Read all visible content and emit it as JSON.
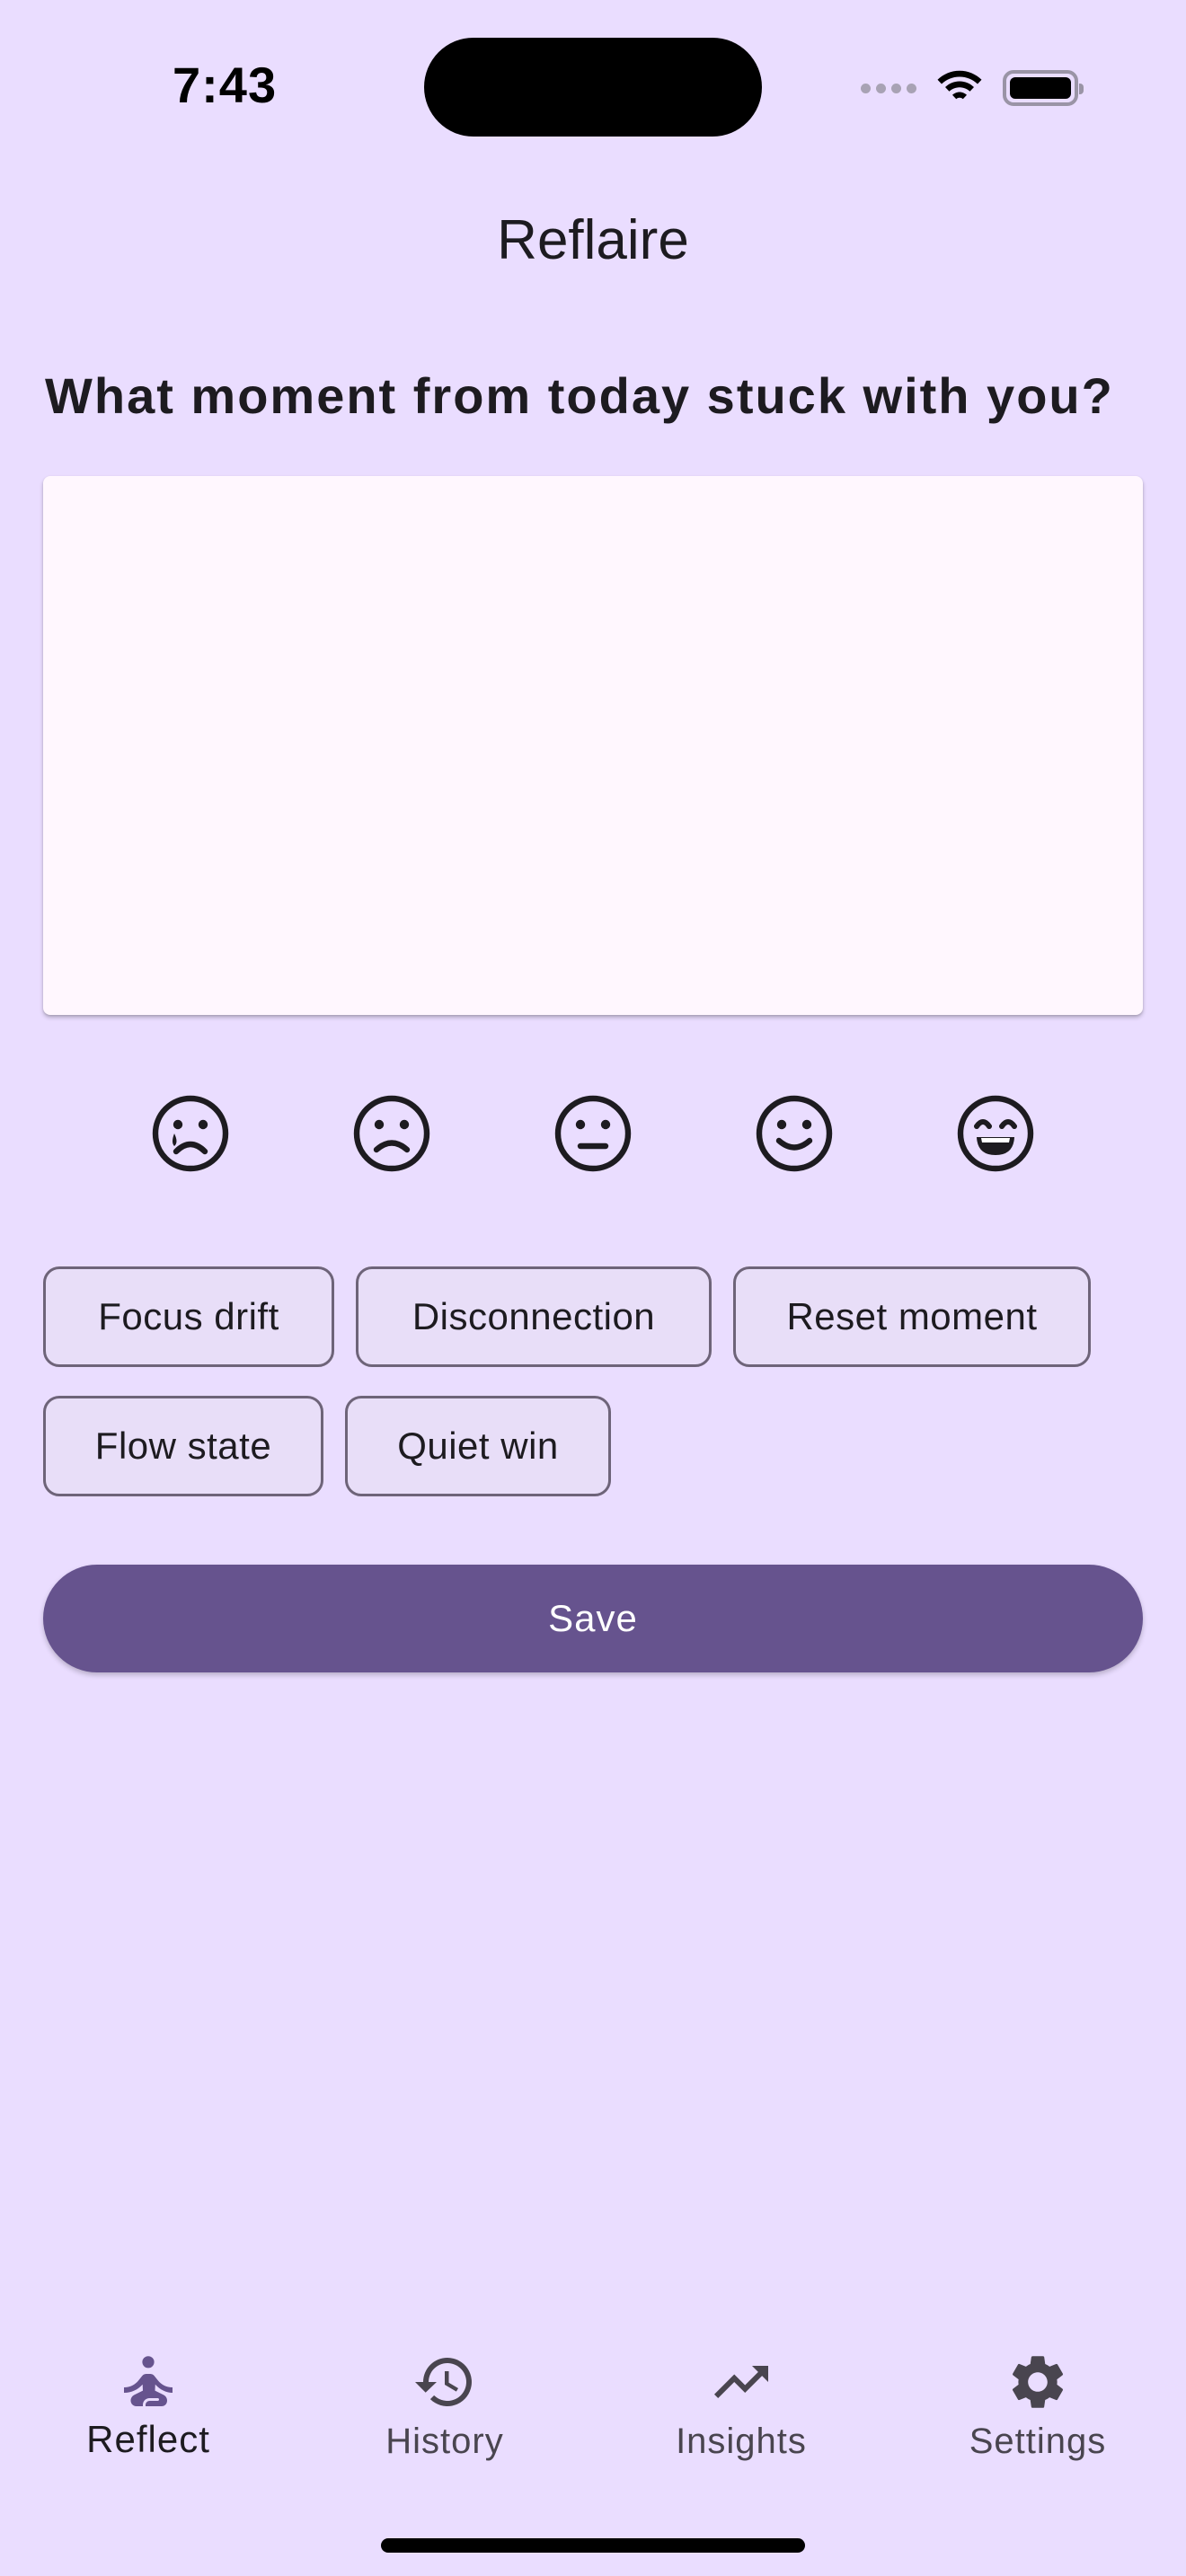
{
  "status_bar": {
    "time": "7:43"
  },
  "app": {
    "title": "Reflaire"
  },
  "reflect": {
    "prompt": "What moment from today stuck with you?",
    "entry_value": "",
    "moods": [
      {
        "icon": "very-sad-face-icon"
      },
      {
        "icon": "sad-face-icon"
      },
      {
        "icon": "neutral-face-icon"
      },
      {
        "icon": "happy-face-icon"
      },
      {
        "icon": "very-happy-face-icon"
      }
    ],
    "tags": [
      "Focus drift",
      "Disconnection",
      "Reset moment",
      "Flow state",
      "Quiet win"
    ],
    "save_label": "Save"
  },
  "nav": {
    "items": [
      {
        "label": "Reflect",
        "icon": "meditation-icon",
        "active": true
      },
      {
        "label": "History",
        "icon": "history-icon",
        "active": false
      },
      {
        "label": "Insights",
        "icon": "trending-up-icon",
        "active": false
      },
      {
        "label": "Settings",
        "icon": "gear-icon",
        "active": false
      }
    ]
  },
  "colors": {
    "background": "#EADDFF",
    "primary": "#66538E",
    "surface": "#FFF7FE",
    "chip_bg": "#E8DEF8",
    "chip_border": "#6E6479",
    "text": "#1D1B20"
  }
}
